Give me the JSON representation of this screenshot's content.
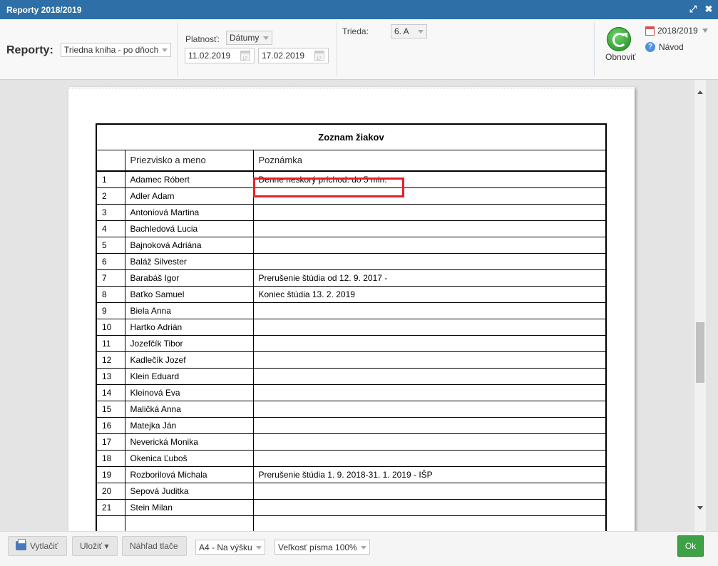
{
  "window": {
    "title": "Reporty 2018/2019"
  },
  "toolbar": {
    "reports_label": "Reporty:",
    "report_type": "Triedna kniha - po dňoch",
    "validity_label": "Platnosť:",
    "validity_mode": "Dátumy",
    "date_from": "11.02.2019",
    "date_to": "17.02.2019",
    "class_label": "Trieda:",
    "class_value": "6. A",
    "refresh_label": "Obnoviť",
    "school_year": "2018/2019",
    "help_label": "Návod"
  },
  "report": {
    "title": "Zoznam žiakov",
    "columns": [
      "",
      "Priezvisko a meno",
      "Poznámka"
    ],
    "rows": [
      [
        "1",
        "Adamec Róbert",
        "Denne neskorý príchod: do 5 min."
      ],
      [
        "2",
        "Adler Adam",
        ""
      ],
      [
        "3",
        "Antoniová Martina",
        ""
      ],
      [
        "4",
        "Bachledová Lucia",
        ""
      ],
      [
        "5",
        "Bajnoková Adriána",
        ""
      ],
      [
        "6",
        "Baláž Silvester",
        ""
      ],
      [
        "7",
        "Barabáš Igor",
        "Prerušenie štúdia od 12. 9. 2017 -"
      ],
      [
        "8",
        "Baťko Samuel",
        "Koniec štúdia 13. 2. 2019"
      ],
      [
        "9",
        "Biela Anna",
        ""
      ],
      [
        "10",
        "Hartko Adrián",
        ""
      ],
      [
        "11",
        "Jozefčík Tibor",
        ""
      ],
      [
        "12",
        "Kadlečík Jozef",
        ""
      ],
      [
        "13",
        "Klein Eduard",
        ""
      ],
      [
        "14",
        "Kleinová Eva",
        ""
      ],
      [
        "15",
        "Maličká Anna",
        ""
      ],
      [
        "16",
        "Matejka Ján",
        ""
      ],
      [
        "17",
        "Neverická Monika",
        ""
      ],
      [
        "18",
        "Okenica Ľuboš",
        ""
      ],
      [
        "19",
        "Rozborilová Michala",
        "Prerušenie štúdia 1. 9. 2018-31. 1. 2019 - IŠP"
      ],
      [
        "20",
        "Sepová Juditka",
        ""
      ],
      [
        "21",
        "Stein Milan",
        ""
      ],
      [
        "",
        "",
        ""
      ]
    ]
  },
  "footer": {
    "print_label": "Vytlačiť",
    "save_label": "Uložiť ▾",
    "preview_label": "Náhľad tlače",
    "page_format": "A4 - Na výšku",
    "font_size": "Veľkosť písma 100%",
    "ok_label": "Ok"
  },
  "colors": {
    "titlebar": "#2d6fa6",
    "highlight": "#e52226",
    "ok_button": "#3ea146"
  }
}
